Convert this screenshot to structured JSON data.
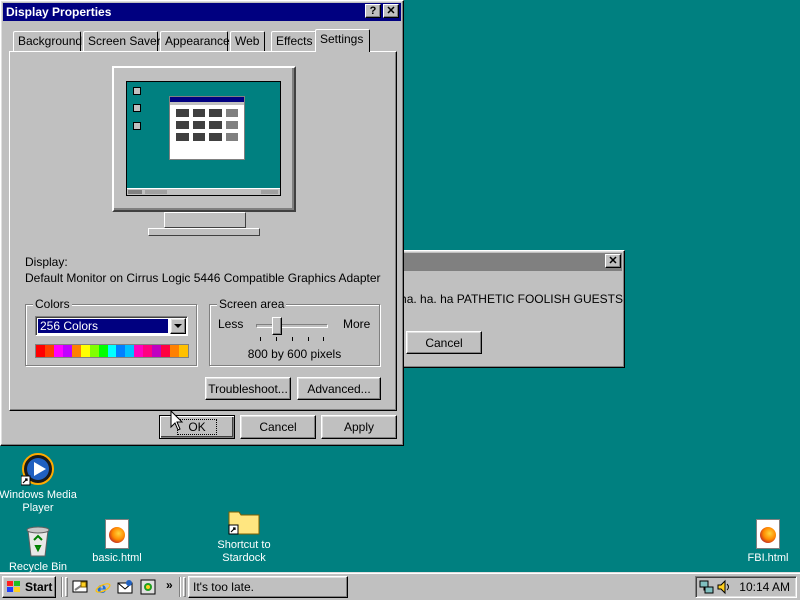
{
  "display_properties": {
    "title": "Display Properties",
    "help_button": "?",
    "close_button": "✕",
    "tabs": [
      "Background",
      "Screen Saver",
      "Appearance",
      "Web",
      "Effects",
      "Settings"
    ],
    "active_tab": "Settings",
    "display_label": "Display:",
    "display_value": "Default Monitor on Cirrus Logic 5446 Compatible Graphics Adapter",
    "colors": {
      "group_label": "Colors",
      "selected": "256 Colors",
      "palette": [
        "#ff0000",
        "#ff4000",
        "#ff00ff",
        "#c000ff",
        "#ff8000",
        "#ffff00",
        "#80ff00",
        "#00ff00",
        "#00ffff",
        "#0080ff",
        "#00c0ff",
        "#ff00c0",
        "#ff0080",
        "#c000c0",
        "#ff0040",
        "#ff8000",
        "#ffc000"
      ]
    },
    "screen_area": {
      "group_label": "Screen area",
      "less_label": "Less",
      "more_label": "More",
      "resolution_text": "800 by 600 pixels",
      "slider_fraction": 0.25
    },
    "troubleshoot_button": "Troubleshoot...",
    "advanced_button": "Advanced...",
    "ok_button": "OK",
    "cancel_button": "Cancel",
    "apply_button": "Apply"
  },
  "background_dialog": {
    "close_button": "✕",
    "message": "ha. ha. ha. ha PATHETIC FOOLISH GUESTS!",
    "cancel_button": "Cancel"
  },
  "desktop_icons": [
    {
      "label": "Windows Media Player",
      "icon": "media-player-icon"
    },
    {
      "label": "Recycle Bin",
      "icon": "recycle-bin-icon"
    },
    {
      "label": "basic.html",
      "icon": "firefox-document-icon"
    },
    {
      "label": "Shortcut to Stardock",
      "icon": "folder-shortcut-icon"
    },
    {
      "label": "FBI.html",
      "icon": "firefox-document-icon"
    }
  ],
  "taskbar": {
    "start_label": "Start",
    "quick_launch": [
      "show-desktop-icon",
      "internet-explorer-icon",
      "outlook-express-icon",
      "channels-icon"
    ],
    "chevron": "»",
    "task_button_label": "It's too late.",
    "tray_icons": [
      "network-icon",
      "volume-icon"
    ],
    "clock": "10:14 AM"
  },
  "colors": {
    "desktop": "#008080",
    "face": "#c0c0c0",
    "active_title": "#000080",
    "inactive_title": "#808080"
  }
}
